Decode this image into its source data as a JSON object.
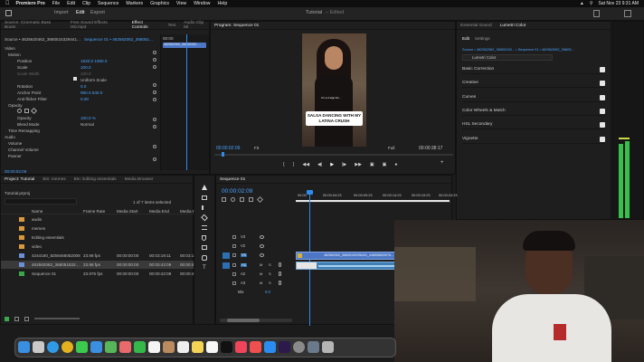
{
  "menubar": {
    "app": "Premiere Pro",
    "items": [
      "File",
      "Edit",
      "Clip",
      "Sequence",
      "Markers",
      "Graphics",
      "View",
      "Window",
      "Help"
    ],
    "clock": "Sat Nov 23  9:31 AM"
  },
  "header": {
    "tabs": [
      "Import",
      "Edit",
      "Export"
    ],
    "title": "Tutorial",
    "edited": "– Edited"
  },
  "source_panel": {
    "tabs": [
      "Source: Cinematic Bass Boom",
      "Free Sound Effects HD.mp3",
      "Effect Controls",
      "Text",
      "Audio Clip Mi"
    ],
    "source_label": "Source • 4625620462_3680515329441...",
    "sequence_label": "Sequence 01 • 462562062_368051...",
    "sections": [
      "Video",
      "Motion",
      "Position",
      "Scale",
      "Scale Width",
      "Uniform Scale",
      "Rotation",
      "Anchor Point",
      "Anti-flicker Filter",
      "Opacity",
      "Opacity",
      "Blend Mode",
      "Time Remapping",
      "Audio",
      "Volume",
      "Channel Volume",
      "Panner"
    ],
    "position_val": "1920.0   1080.0",
    "scale_val": "100.0",
    "scale_width_val": "100.0",
    "rotation_val": "0.0",
    "anchor_val": "960.0   540.0",
    "antiflicker_val": "0.00",
    "opacity_val": "100.0 %",
    "blend_val": "Normal",
    "uniform_label": "Uniform Scale",
    "timecode": "00:00:02:09",
    "ruler_label": "00:00",
    "clip_label": "462562062_36805152..."
  },
  "program": {
    "title": "Program: Sequence 01",
    "caption_main": "SALSA DANCING WITH MY",
    "caption_sub": "LATINA CRUSH",
    "small_caption": "I'm a 4 sign for...",
    "timecode_left": "00:00:02:09",
    "fit": "Fit",
    "quality": "Full",
    "timecode_right": "00:00:38:17"
  },
  "lumetri": {
    "tabs": [
      "Essential Sound",
      "Lumetri Color"
    ],
    "subtabs": [
      "Edit",
      "Settings"
    ],
    "source_line": "Source • 462562062_36805153...  •  Sequence 01 • 462562062_36805...",
    "dropdown": "Lumetri Color",
    "sections": [
      "Basic Correction",
      "Creative",
      "Curves",
      "Color Wheels & Match",
      "HSL Secondary",
      "Vignette"
    ]
  },
  "project": {
    "tabs": [
      "Project: Tutorial",
      "Bin: memes",
      "Bin: Editing essentials",
      "Media Browser"
    ],
    "file": "Tutorial.prproj",
    "count": "1 of 7 items selected",
    "columns": [
      "Name",
      "Frame Rate",
      "Media Start",
      "Media End",
      "Media Duration"
    ],
    "items": [
      {
        "name": "audio",
        "fr": "",
        "ms": "",
        "me": "",
        "md": ""
      },
      {
        "name": "memes",
        "fr": "",
        "ms": "",
        "me": "",
        "md": ""
      },
      {
        "name": "Editing essentials",
        "fr": "",
        "ms": "",
        "me": "",
        "md": ""
      },
      {
        "name": "video",
        "fr": "",
        "ms": "",
        "me": "",
        "md": ""
      },
      {
        "name": "4244160_8259466052008",
        "fr": "23.98 fps",
        "ms": "00:00:00:00",
        "me": "00:03:19:11",
        "md": "00:03:19:12"
      },
      {
        "name": "462562062_368051532...",
        "fr": "23.98 fps",
        "ms": "00:00:00:00",
        "me": "00:00:42:09",
        "md": "00:00:42:10"
      },
      {
        "name": "Sequence 01",
        "fr": "23.976 fps",
        "ms": "00:00:00:00",
        "me": "00:00:42:08",
        "md": "00:00:42:09"
      }
    ]
  },
  "timeline": {
    "tab": "Sequence 01",
    "timecode": "00:00:02:09",
    "ruler": [
      "00:00",
      "00:00:04:23",
      "00:00:09:23",
      "00:00:14:23",
      "00:00:19:23",
      "00:00:24:23"
    ],
    "tracks": [
      "V3",
      "V2",
      "V1",
      "A1",
      "A2",
      "A3",
      "Mix"
    ],
    "mix_val": "0.0",
    "clip_label": "462562062_36805153296441_448558809076..."
  },
  "colors": {
    "accent": "#2d8ceb",
    "clip_video": "#4d77c4",
    "clip_audio": "#3f7fb5",
    "meter": "#36c24a"
  }
}
